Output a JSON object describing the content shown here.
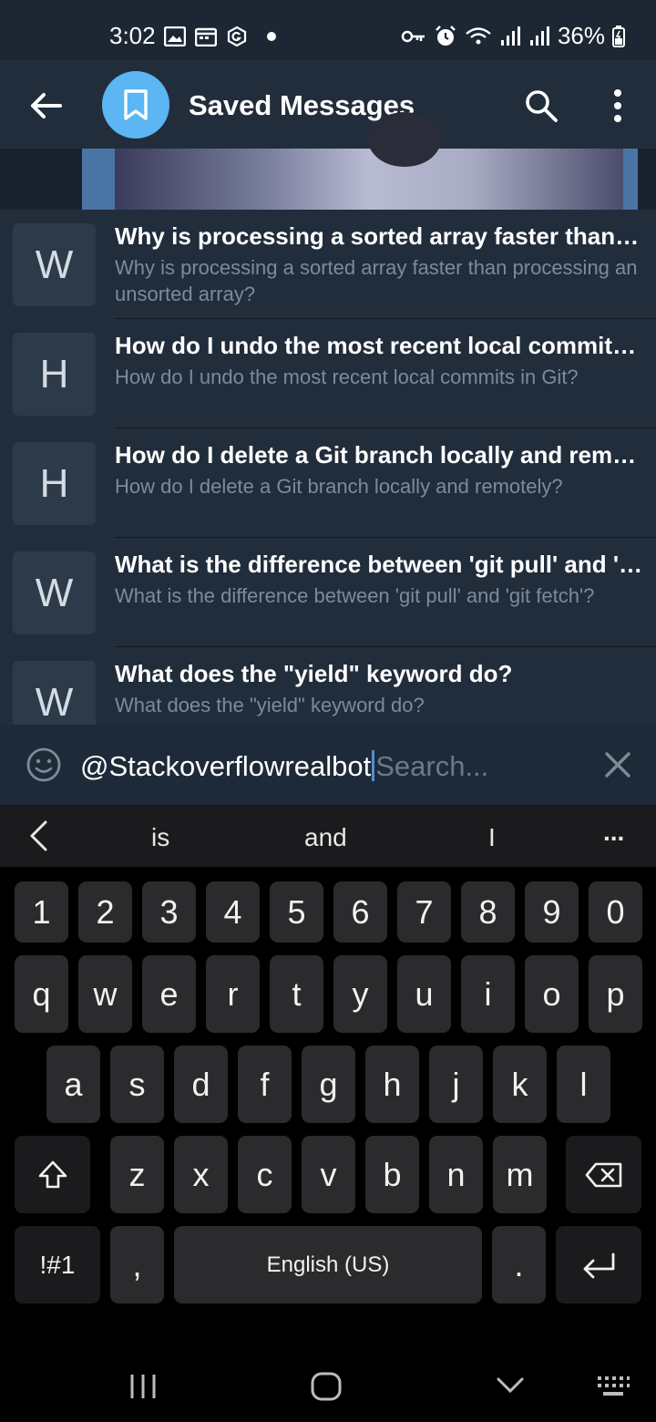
{
  "status_bar": {
    "time": "3:02",
    "battery": "36%"
  },
  "header": {
    "title": "Saved Messages"
  },
  "results": [
    {
      "letter": "W",
      "title": "Why is processing a sorted array faster than p...",
      "subtitle": "Why is processing a sorted array faster than processing an unsorted array?"
    },
    {
      "letter": "H",
      "title": "How do I undo the most recent local commits...",
      "subtitle": "How do I undo the most recent local commits in Git?"
    },
    {
      "letter": "H",
      "title": "How do I delete a Git branch locally and remot...",
      "subtitle": "How do I delete a Git branch locally and remotely?"
    },
    {
      "letter": "W",
      "title": "What is the difference between 'git pull' and 'gi...",
      "subtitle": "What is the difference between 'git pull' and 'git fetch'?"
    },
    {
      "letter": "W",
      "title": "What does the \"yield\" keyword do?",
      "subtitle": "What does the \"yield\" keyword do?"
    }
  ],
  "input": {
    "value": "@Stackoverflowrealbot",
    "placeholder": "Search..."
  },
  "suggestions": {
    "words": [
      "is",
      "and",
      "I"
    ],
    "more": "..."
  },
  "keyboard": {
    "numbers": [
      "1",
      "2",
      "3",
      "4",
      "5",
      "6",
      "7",
      "8",
      "9",
      "0"
    ],
    "row1": [
      "q",
      "w",
      "e",
      "r",
      "t",
      "y",
      "u",
      "i",
      "o",
      "p"
    ],
    "row2": [
      "a",
      "s",
      "d",
      "f",
      "g",
      "h",
      "j",
      "k",
      "l"
    ],
    "row3": [
      "z",
      "x",
      "c",
      "v",
      "b",
      "n",
      "m"
    ],
    "symbols_label": "!#1",
    "comma": ",",
    "space_label": "English (US)",
    "period": "."
  },
  "colors": {
    "accent": "#5bb6f3",
    "header_bg": "#212d3b",
    "caret": "#4e8fd0"
  }
}
